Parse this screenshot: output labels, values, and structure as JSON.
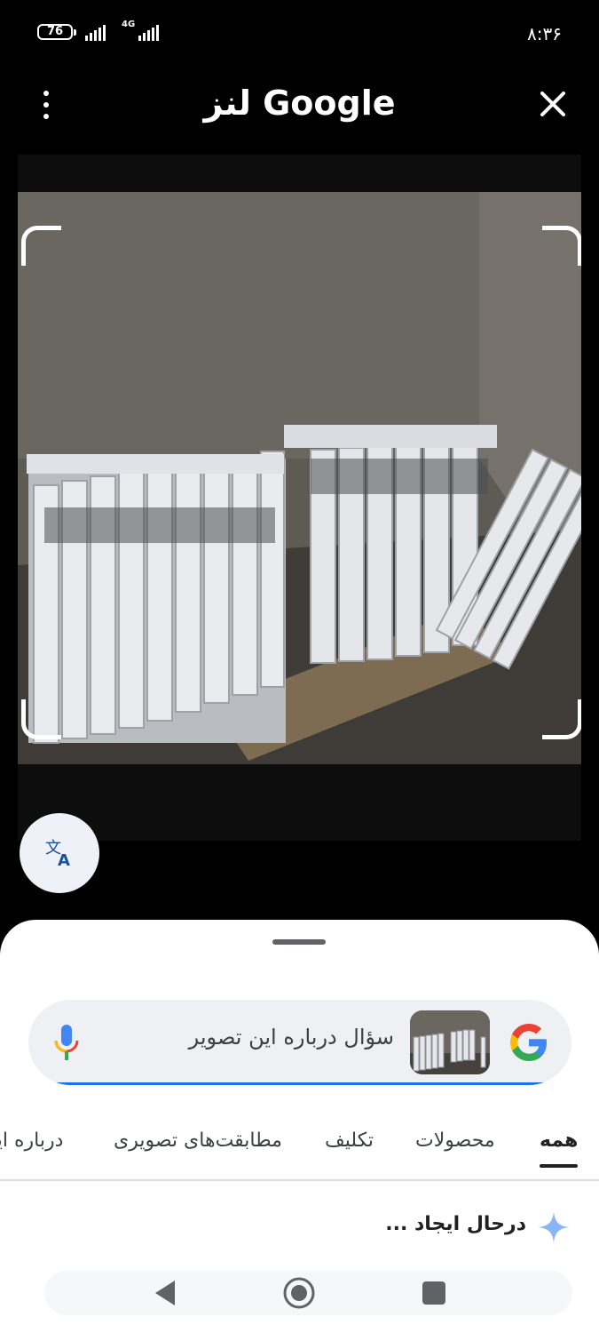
{
  "status_bar": {
    "battery": "76",
    "network": "4G",
    "time": "۸:۳۶"
  },
  "header": {
    "title": "لنز Google",
    "menu_icon": "more-vert-icon",
    "close_icon": "close-icon"
  },
  "viewer": {
    "image_subject": "radiators-photo",
    "translate_icon": "translate-icon"
  },
  "search": {
    "placeholder": "سؤال درباره این تصویر",
    "logo_icon": "google-g-icon",
    "mic_icon": "mic-icon"
  },
  "tabs": [
    {
      "label": "همه",
      "active": true
    },
    {
      "label": "محصولات",
      "active": false
    },
    {
      "label": "تکلیف",
      "active": false
    },
    {
      "label": "مطابقت‌های تصویری",
      "active": false
    },
    {
      "label": "درباره این",
      "active": false
    }
  ],
  "results": {
    "status": "درحال ایجاد ...",
    "icon": "sparkle-icon"
  },
  "colors": {
    "accent": "#1a73e8",
    "sparkle": "#8ab4f8"
  }
}
